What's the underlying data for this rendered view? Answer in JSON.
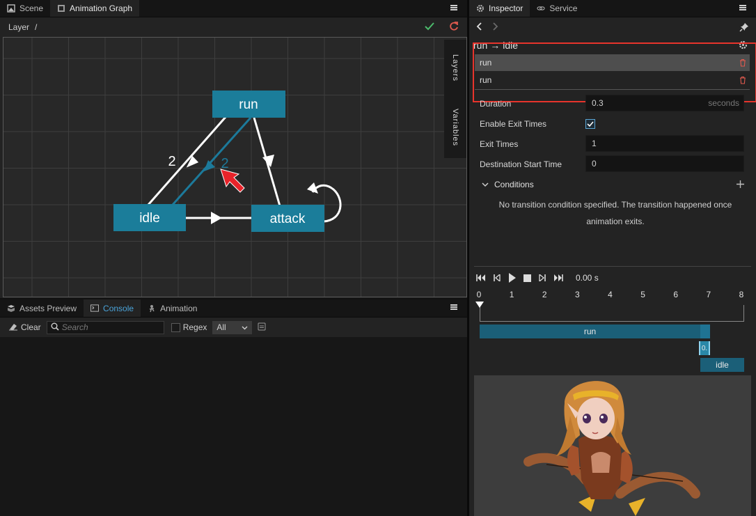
{
  "left_top": {
    "tabs": [
      {
        "label": "Scene",
        "active": false
      },
      {
        "label": "Animation Graph",
        "active": true
      }
    ],
    "layer_label": "Layer",
    "layer_path": "/",
    "side_tabs": [
      "Layers",
      "Variables"
    ]
  },
  "graph": {
    "states": [
      {
        "id": "run",
        "label": "run"
      },
      {
        "id": "idle",
        "label": "idle"
      },
      {
        "id": "attack",
        "label": "attack"
      }
    ],
    "transition_counts": [
      {
        "between": "idle-run",
        "count": "2",
        "selected": false
      },
      {
        "between": "run-idle",
        "count": "2",
        "selected": true
      }
    ],
    "colors": {
      "node": "#1b7d9a",
      "selected_edge": "#1c7a9b",
      "edge": "#ffffff",
      "grid": "#3e3e3e",
      "cursor": "#e8232a"
    }
  },
  "left_bottom": {
    "tabs": [
      {
        "label": "Assets Preview",
        "active": false
      },
      {
        "label": "Console",
        "active": true
      },
      {
        "label": "Animation",
        "active": false
      }
    ],
    "clear_label": "Clear",
    "search_placeholder": "Search",
    "regex_label": "Regex",
    "filter_value": "All"
  },
  "right": {
    "tabs": [
      {
        "label": "Inspector",
        "active": true
      },
      {
        "label": "Service",
        "active": false
      }
    ],
    "transition_title": {
      "from": "run",
      "arrow": "→",
      "to": "idle"
    },
    "transitions": [
      "run",
      "run"
    ],
    "duration_label": "Duration",
    "duration_value": "0.3",
    "duration_unit": "seconds",
    "enable_exit_label": "Enable Exit Times",
    "enable_exit_checked": true,
    "exit_times_label": "Exit Times",
    "exit_times_value": "1",
    "dest_start_label": "Destination Start Time",
    "dest_start_value": "0",
    "conditions_label": "Conditions",
    "no_condition_text": "No transition condition specified. The transition happened once animation exits.",
    "time_display": "0.00 s",
    "ticks": [
      "0",
      "1",
      "2",
      "3",
      "4",
      "5",
      "6",
      "7",
      "8"
    ],
    "bars": {
      "source": "run",
      "blend": "0.",
      "target": "idle"
    }
  }
}
